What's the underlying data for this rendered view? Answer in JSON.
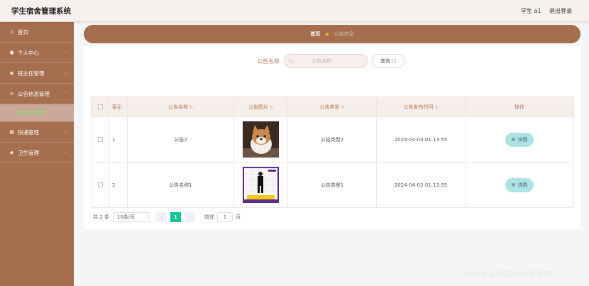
{
  "header": {
    "title": "学生宿舍管理系统",
    "user": "学生 a1",
    "logout": "退出登录"
  },
  "sidebar": {
    "items": [
      {
        "label": "首页",
        "icon": "home-icon"
      },
      {
        "label": "个人中心",
        "icon": "user-icon"
      },
      {
        "label": "班主任管理",
        "icon": "shield-icon"
      },
      {
        "label": "公告信息管理",
        "icon": "list-icon"
      },
      {
        "label": "快递管理",
        "icon": "grid-icon"
      },
      {
        "label": "卫生管理",
        "icon": "shield-icon"
      }
    ],
    "active_sub": "公告信息管理"
  },
  "breadcrumb": {
    "home": "首页",
    "current": "公告信息"
  },
  "search": {
    "label": "公告名称",
    "placeholder": "公告名称",
    "button": "查询"
  },
  "table": {
    "headers": [
      "索引",
      "公告名称",
      "公告图片",
      "公告类型",
      "公告发布时间",
      "操作"
    ],
    "rows": [
      {
        "index": "1",
        "name": "公告2",
        "type": "公告类型2",
        "time": "2024-04-03 01:13:55",
        "action": "详情",
        "image": "shiba-dog-photo"
      },
      {
        "index": "2",
        "name": "公告名称1",
        "type": "公告类型1",
        "time": "2024-04-03 01:13:55",
        "action": "详情",
        "image": "poster-photo"
      }
    ]
  },
  "pagination": {
    "total": "共 2 条",
    "page_size": "10条/页",
    "current_page": "1",
    "goto_label": "前往",
    "goto_value": "1",
    "page_unit": "页"
  },
  "watermark": "CSDN @无敌の小さな蚊",
  "colors": {
    "brand": "#a56e4f",
    "accent_green": "#13c49a",
    "detail_button": "#aee3e6"
  }
}
